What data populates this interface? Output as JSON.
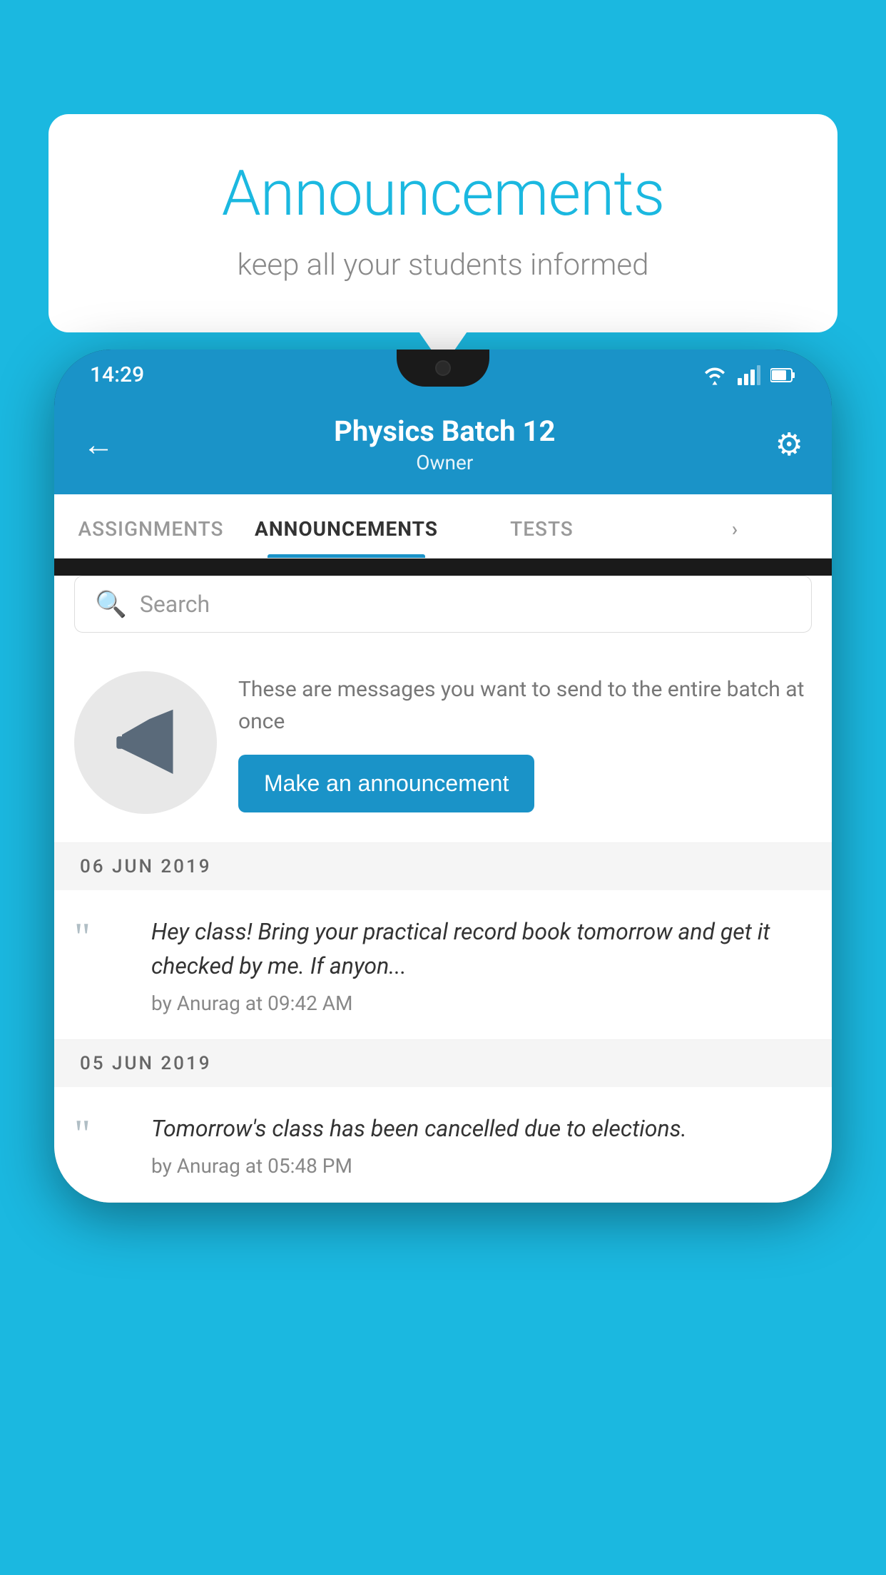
{
  "background_color": "#1bb8e0",
  "speech_bubble": {
    "title": "Announcements",
    "subtitle": "keep all your students informed"
  },
  "phone": {
    "status_bar": {
      "time": "14:29",
      "wifi_icon": "wifi",
      "signal_icon": "signal",
      "battery_icon": "battery"
    },
    "header": {
      "back_label": "←",
      "title": "Physics Batch 12",
      "subtitle": "Owner",
      "gear_label": "⚙"
    },
    "tabs": [
      {
        "label": "ASSIGNMENTS",
        "active": false
      },
      {
        "label": "ANNOUNCEMENTS",
        "active": true
      },
      {
        "label": "TESTS",
        "active": false
      },
      {
        "label": "...",
        "active": false
      }
    ],
    "search": {
      "placeholder": "Search"
    },
    "promo": {
      "description": "These are messages you want to send to the entire batch at once",
      "button_label": "Make an announcement"
    },
    "announcements": [
      {
        "date": "06  JUN  2019",
        "message": "Hey class! Bring your practical record book tomorrow and get it checked by me. If anyon...",
        "author": "by Anurag at 09:42 AM"
      },
      {
        "date": "05  JUN  2019",
        "message": "Tomorrow's class has been cancelled due to elections.",
        "author": "by Anurag at 05:48 PM"
      }
    ]
  }
}
